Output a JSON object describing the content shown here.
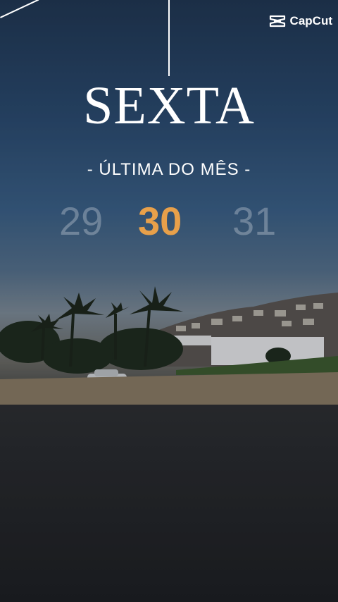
{
  "brand": {
    "logo_text": "CapCut",
    "icon": "capcut-logo-icon"
  },
  "title": "SEXTA",
  "subtitle": "- ÚLTIMA DO MÊS -",
  "days": {
    "prev": "29",
    "current": "30",
    "next": "31"
  },
  "colors": {
    "accent": "#e8a04a",
    "text": "#ffffff"
  }
}
